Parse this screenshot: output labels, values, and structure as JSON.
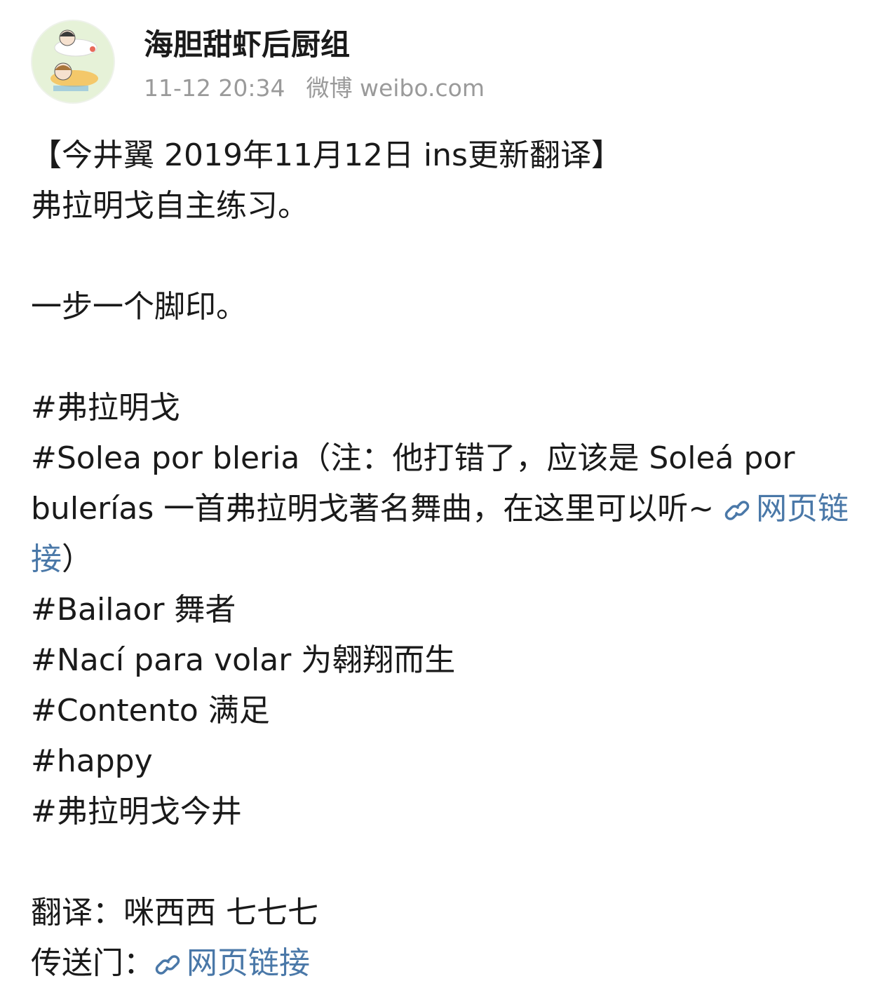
{
  "post": {
    "author": "海胆甜虾后厨组",
    "time": "11-12 20:34",
    "source": "微博 weibo.com"
  },
  "content": {
    "title": "【今井翼 2019年11月12日 ins更新翻译】",
    "line1": "弗拉明戈自主练习。",
    "line2": "一步一个脚印。",
    "tag1": "#弗拉明戈",
    "tag2_text": "#Solea por bleria（注：他打错了，应该是 Soleá por bulerías 一首弗拉明戈著名舞曲，在这里可以听~ ",
    "tag2_link": "网页链接",
    "tag2_close": "）",
    "tag3": "#Bailaor 舞者",
    "tag4": "#Nací para volar 为翱翔而生",
    "tag5": "#Contento 满足",
    "tag6": "#happy",
    "tag7": "#弗拉明戈今井",
    "translator": "翻译：咪西西 七七七",
    "portal_label": "传送门：",
    "portal_link": "网页链接"
  },
  "colors": {
    "link": "#4a78a8",
    "meta": "#9a9a9a",
    "text": "#1a1a1a"
  },
  "icons": {
    "link_icon": "link-chain-icon",
    "avatar": "avatar-illustration"
  }
}
